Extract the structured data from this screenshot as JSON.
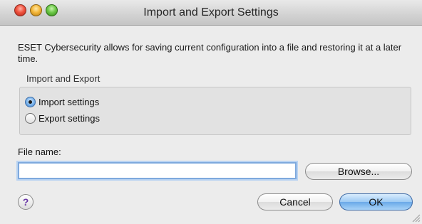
{
  "window": {
    "title": "Import and Export Settings"
  },
  "description": "ESET Cybersecurity allows for saving current configuration into a file and restoring it at a later time.",
  "group": {
    "label": "Import and Export",
    "options": [
      {
        "label": "Import settings",
        "selected": true
      },
      {
        "label": "Export settings",
        "selected": false
      }
    ]
  },
  "file": {
    "label": "File name:",
    "value": "",
    "browse_label": "Browse..."
  },
  "footer": {
    "help_label": "?",
    "cancel_label": "Cancel",
    "ok_label": "OK"
  },
  "colors": {
    "accent": "#6aa9e8",
    "focus_ring": "#7ea9dd"
  },
  "icons": {
    "close": "close-icon",
    "minimize": "minimize-icon",
    "zoom": "zoom-icon",
    "help": "help-icon",
    "resize": "resize-grip-icon"
  }
}
